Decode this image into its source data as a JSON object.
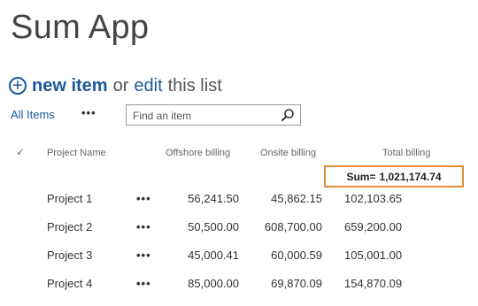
{
  "page": {
    "title": "Sum App"
  },
  "command_bar": {
    "new_item_label": "new item",
    "or_text": "or",
    "edit_label": "edit",
    "this_list_text": "this list"
  },
  "views": {
    "all_items_label": "All Items",
    "more_label": "•••"
  },
  "search": {
    "placeholder": "Find an item"
  },
  "table": {
    "columns": [
      "Project Name",
      "Offshore billing",
      "Onsite billing",
      "Total billing"
    ],
    "sum_label": "Sum=",
    "sum_value": "1,021,174.74",
    "row_menu_label": "•••",
    "rows": [
      {
        "name": "Project 1",
        "offshore": "56,241.50",
        "onsite": "45,862.15",
        "total": "102,103.65"
      },
      {
        "name": "Project 2",
        "offshore": "50,500.00",
        "onsite": "608,700.00",
        "total": "659,200.00"
      },
      {
        "name": "Project 3",
        "offshore": "45,000.41",
        "onsite": "60,000.59",
        "total": "105,001.00"
      },
      {
        "name": "Project 4",
        "offshore": "85,000.00",
        "onsite": "69,870.09",
        "total": "154,870.09"
      }
    ]
  },
  "colors": {
    "link": "#1a5a9a",
    "highlight_border": "#e08a3c"
  }
}
